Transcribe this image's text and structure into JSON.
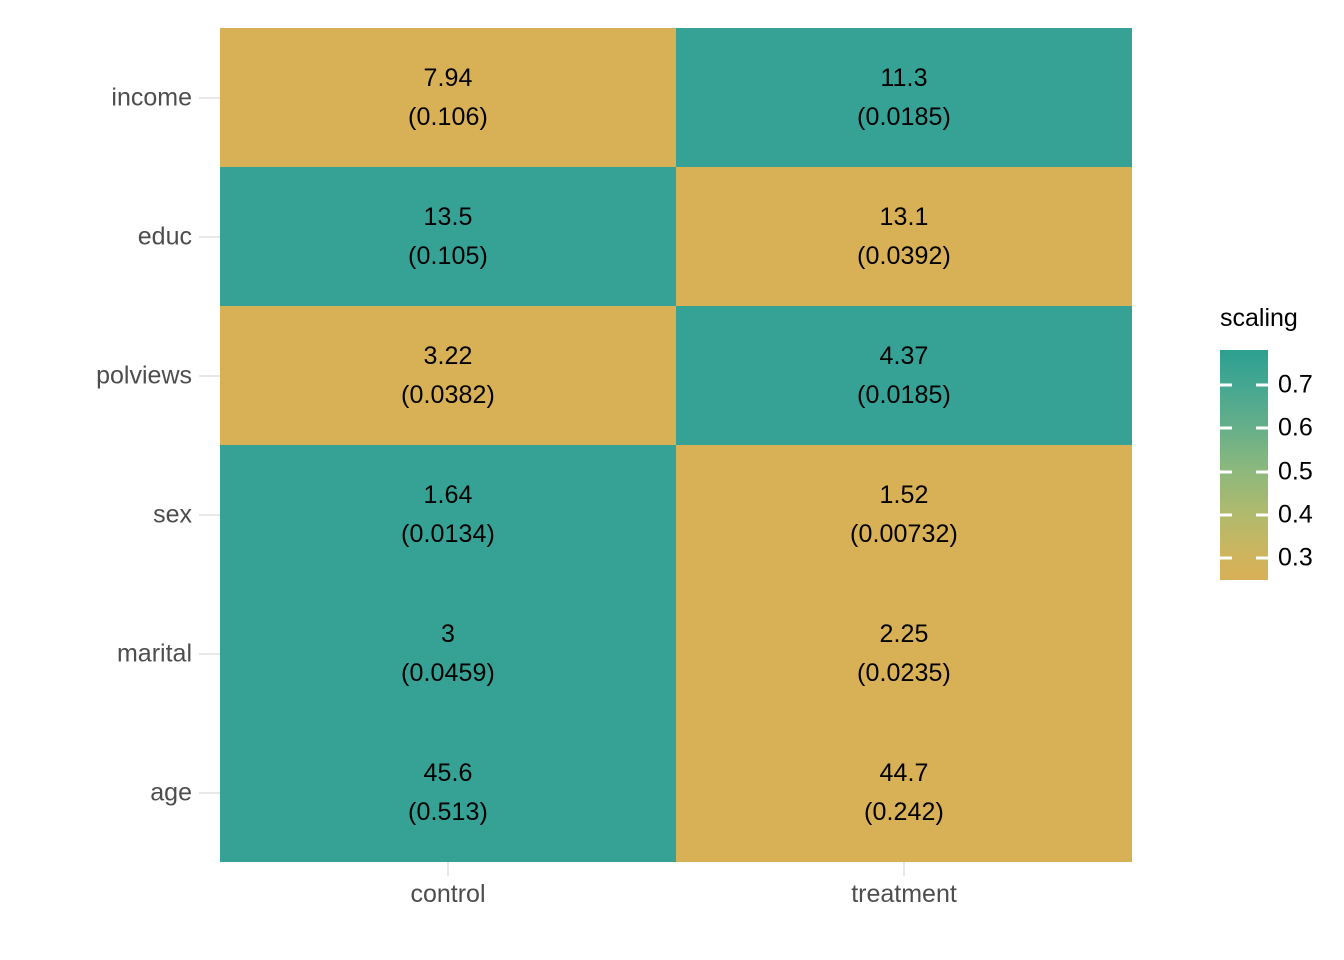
{
  "chart_data": {
    "type": "heatmap",
    "title": "",
    "xlabel": "",
    "ylabel": "",
    "x_categories": [
      "control",
      "treatment"
    ],
    "y_categories": [
      "income",
      "educ",
      "polviews",
      "sex",
      "marital",
      "age"
    ],
    "legend": {
      "title": "scaling",
      "position": "right",
      "type": "continuous-colorbar",
      "tick_labels": [
        "0.7",
        "0.6",
        "0.5",
        "0.4",
        "0.3"
      ],
      "tick_values": [
        0.7,
        0.6,
        0.5,
        0.4,
        0.3
      ],
      "range": [
        0.25,
        0.78
      ],
      "color_high": "#2CA08F",
      "color_low": "#D8B056"
    },
    "cell_label_format": "mean\n(std. error)",
    "cells": [
      {
        "row": "income",
        "col": "control",
        "value": "7.94",
        "se": "(0.106)",
        "fill": "#D8B056"
      },
      {
        "row": "income",
        "col": "treatment",
        "value": "11.3",
        "se": "(0.0185)",
        "fill": "#35A295"
      },
      {
        "row": "educ",
        "col": "control",
        "value": "13.5",
        "se": "(0.105)",
        "fill": "#35A295"
      },
      {
        "row": "educ",
        "col": "treatment",
        "value": "13.1",
        "se": "(0.0392)",
        "fill": "#D8B056"
      },
      {
        "row": "polviews",
        "col": "control",
        "value": "3.22",
        "se": "(0.0382)",
        "fill": "#D8B056"
      },
      {
        "row": "polviews",
        "col": "treatment",
        "value": "4.37",
        "se": "(0.0185)",
        "fill": "#35A295"
      },
      {
        "row": "sex",
        "col": "control",
        "value": "1.64",
        "se": "(0.0134)",
        "fill": "#35A295"
      },
      {
        "row": "sex",
        "col": "treatment",
        "value": "1.52",
        "se": "(0.00732)",
        "fill": "#D8B056"
      },
      {
        "row": "marital",
        "col": "control",
        "value": "3",
        "se": "(0.0459)",
        "fill": "#35A295"
      },
      {
        "row": "marital",
        "col": "treatment",
        "value": "2.25",
        "se": "(0.0235)",
        "fill": "#D8B056"
      },
      {
        "row": "age",
        "col": "control",
        "value": "45.6",
        "se": "(0.513)",
        "fill": "#35A295"
      },
      {
        "row": "age",
        "col": "treatment",
        "value": "44.7",
        "se": "(0.242)",
        "fill": "#D8B056"
      }
    ]
  },
  "colors": {
    "teal": "#35A295",
    "gold": "#D8B056",
    "axis_text": "#4d4d4d",
    "tick_line": "#e8e8e8",
    "background": "#ffffff"
  }
}
